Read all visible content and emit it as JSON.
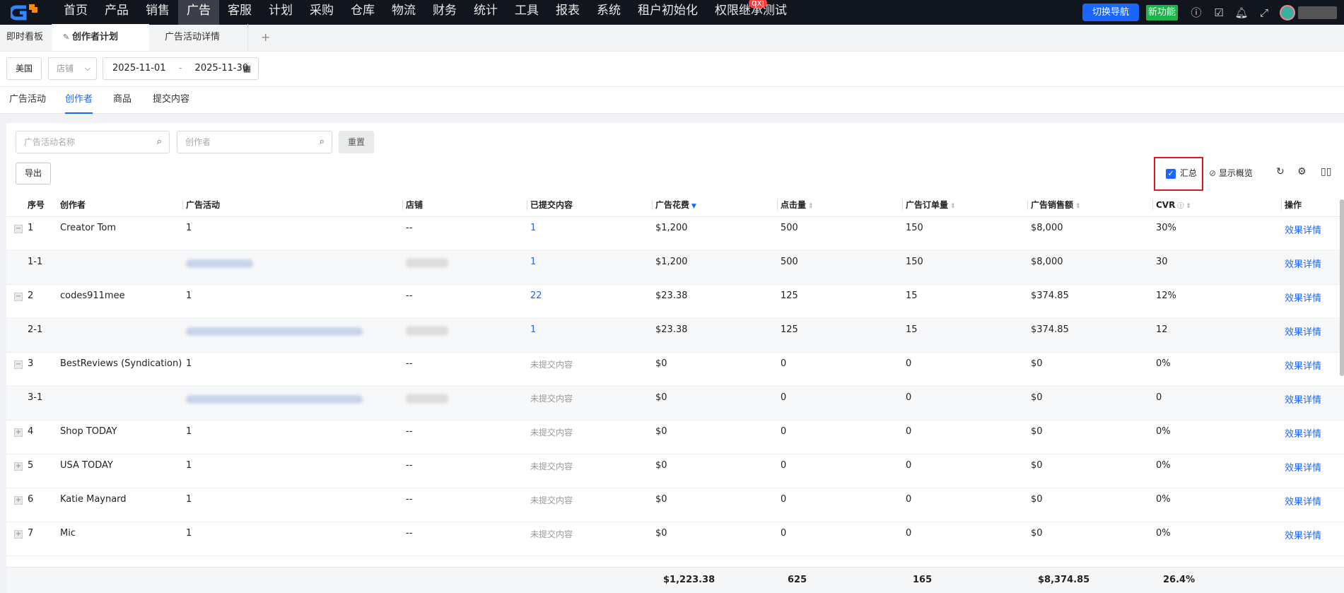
{
  "nav": {
    "items": [
      "首页",
      "产品",
      "销售",
      "广告",
      "客服",
      "计划",
      "采购",
      "仓库",
      "物流",
      "财务",
      "统计",
      "工具",
      "报表",
      "系统",
      "租户初始化",
      "权限继承测试"
    ],
    "active": "广告",
    "badge": "qxj",
    "switch_nav": "切换导航",
    "new_feature": "新功能"
  },
  "page_tabs": {
    "dashboard": "即时看板",
    "creator_plan": "创作者计划",
    "campaign_detail": "广告活动详情",
    "add": "+"
  },
  "filters": {
    "country": "美国",
    "shop_placeholder": "店铺",
    "date_start": "2025-11-01",
    "date_sep": "-",
    "date_end": "2025-11-30"
  },
  "sub_tabs": [
    "广告活动",
    "创作者",
    "商品",
    "提交内容"
  ],
  "sub_tab_active": "创作者",
  "toolbar": {
    "campaign_placeholder": "广告活动名称",
    "creator_placeholder": "创作者",
    "reset": "重置",
    "export": "导出",
    "summary_label": "汇总",
    "summary_checked": true,
    "overview_label": "显示概览"
  },
  "table": {
    "headers": {
      "no": "序号",
      "creator": "创作者",
      "campaign": "广告活动",
      "shop": "店铺",
      "submitted": "已提交内容",
      "spend": "广告花费",
      "clicks": "点击量",
      "orders": "广告订单量",
      "sales": "广告销售额",
      "cvr": "CVR",
      "action": "操作"
    },
    "rows": [
      {
        "no": "1",
        "creator": "Creator Tom",
        "campaign": "1",
        "shop": "--",
        "submitted": "1",
        "spend": "$1,200",
        "clicks": "500",
        "orders": "150",
        "sales": "$8,000",
        "cvr": "30%",
        "action": "效果详情"
      },
      {
        "no": "1-1",
        "creator": "",
        "campaign": "",
        "shop": "",
        "submitted": "1",
        "spend": "$1,200",
        "clicks": "500",
        "orders": "150",
        "sales": "$8,000",
        "cvr": "30",
        "action": "效果详情"
      },
      {
        "no": "2",
        "creator": "codes911mee",
        "campaign": "1",
        "shop": "--",
        "submitted": "22",
        "spend": "$23.38",
        "clicks": "125",
        "orders": "15",
        "sales": "$374.85",
        "cvr": "12%",
        "action": "效果详情"
      },
      {
        "no": "2-1",
        "creator": "",
        "campaign": "",
        "shop": "",
        "submitted": "1",
        "spend": "$23.38",
        "clicks": "125",
        "orders": "15",
        "sales": "$374.85",
        "cvr": "12",
        "action": "效果详情"
      },
      {
        "no": "3",
        "creator": "BestReviews (Syndication)",
        "campaign": "1",
        "shop": "--",
        "submitted": "未提交内容",
        "spend": "$0",
        "clicks": "0",
        "orders": "0",
        "sales": "$0",
        "cvr": "0%",
        "action": "效果详情"
      },
      {
        "no": "3-1",
        "creator": "",
        "campaign": "",
        "shop": "",
        "submitted": "未提交内容",
        "spend": "$0",
        "clicks": "0",
        "orders": "0",
        "sales": "$0",
        "cvr": "0",
        "action": "效果详情"
      },
      {
        "no": "4",
        "creator": "Shop TODAY",
        "campaign": "1",
        "shop": "--",
        "submitted": "未提交内容",
        "spend": "$0",
        "clicks": "0",
        "orders": "0",
        "sales": "$0",
        "cvr": "0%",
        "action": "效果详情"
      },
      {
        "no": "5",
        "creator": "USA TODAY",
        "campaign": "1",
        "shop": "--",
        "submitted": "未提交内容",
        "spend": "$0",
        "clicks": "0",
        "orders": "0",
        "sales": "$0",
        "cvr": "0%",
        "action": "效果详情"
      },
      {
        "no": "6",
        "creator": "Katie Maynard",
        "campaign": "1",
        "shop": "--",
        "submitted": "未提交内容",
        "spend": "$0",
        "clicks": "0",
        "orders": "0",
        "sales": "$0",
        "cvr": "0%",
        "action": "效果详情"
      },
      {
        "no": "7",
        "creator": "Mic",
        "campaign": "1",
        "shop": "--",
        "submitted": "未提交内容",
        "spend": "$0",
        "clicks": "0",
        "orders": "0",
        "sales": "$0",
        "cvr": "0%",
        "action": "效果详情"
      }
    ],
    "totals": {
      "spend": "$1,223.38",
      "clicks": "625",
      "orders": "165",
      "sales": "$8,374.85",
      "cvr": "26.4%"
    }
  },
  "colors": {
    "accent": "#1a66ff",
    "topbar": "#11151d",
    "highlight_box": "#e0171f",
    "new_badge": "#1db34a"
  }
}
